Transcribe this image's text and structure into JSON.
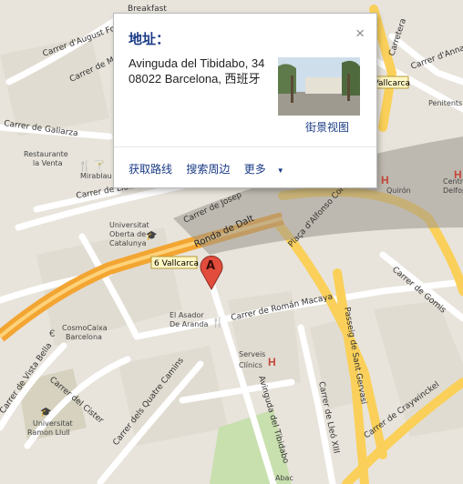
{
  "popup": {
    "title": "地址：",
    "close_glyph": "×",
    "address_line1": "Avinguda del Tibidabo, 34",
    "address_line2": "08022 Barcelona, 西班牙",
    "street_view_label": "街景视图",
    "actions": {
      "directions": "获取路线",
      "search_nearby": "搜索周边",
      "more": "更多"
    }
  },
  "marker": {
    "letter": "A"
  },
  "labels": {
    "august_font": "Carrer d'August Font",
    "breakfast": "Breakfast",
    "carrer_m": "Carrer de M",
    "carrer_galiarza": "Carrer de Galiarza",
    "restaurante_la_venta": [
      "Restaurante",
      "la Venta"
    ],
    "mirablau": "Mirablau",
    "carrer_lluis": "Carrer de Lluís",
    "carrer_josep": "Carrer de Josep",
    "ronda_dalt": "Ronda de Dalt",
    "universitat_oberta": [
      "Universitat",
      "Oberta de",
      "Catalunya"
    ],
    "vallcarca_badge_main": "6 Vallcarca",
    "vallcarca_badge_top": "6 Vallcarca",
    "placa_alfonso": "Plaça d'Alfonso Comín",
    "carrer_gomis": "Carrer de Gomis",
    "carrer_roman": "Carrer de Román Macaya",
    "el_asador": [
      "El Asador",
      "De Aranda"
    ],
    "cosmocaixa": [
      "CosmoCaixa",
      "Barcelona"
    ],
    "serveis_clinics": [
      "Serveis",
      "Clínics"
    ],
    "passeig_gervasi": "Passeig de Sant Gervasi",
    "carrer_vista_bella": "Carrer de Vista Bella",
    "carrer_cister": "Carrer del Cister",
    "carrer_quatre_camins": "Carrer dels Quatre Camins",
    "universitat_ramon": [
      "Universitat",
      "Ramon Llull"
    ],
    "avinguda_tibidabo": "Avinguda del Tibidabo",
    "carrer_lleo": "Carrer de Lleó XIII",
    "carrer_craywinckel": "Carrer de Craywinckel",
    "carretera": "Carretera",
    "carrer_anna": "Carrer d'Anna",
    "penitents": "Penitents",
    "quiron": "Quirón",
    "centro_delfos": [
      "Centro",
      "Delfos"
    ],
    "abac": "Abac"
  },
  "colors": {
    "land": "#e8e4dc",
    "major_road": "#fad05a",
    "orange_road": "#f3a532",
    "minor_road": "#ffffff",
    "park": "#c8dfae",
    "block": "#e1dcd1",
    "link": "#1a3b86",
    "marker": "#e24c3c"
  },
  "icons": [
    "close-icon",
    "restaurant-icon",
    "bar-icon",
    "hospital-icon",
    "museum-icon",
    "university-icon"
  ]
}
